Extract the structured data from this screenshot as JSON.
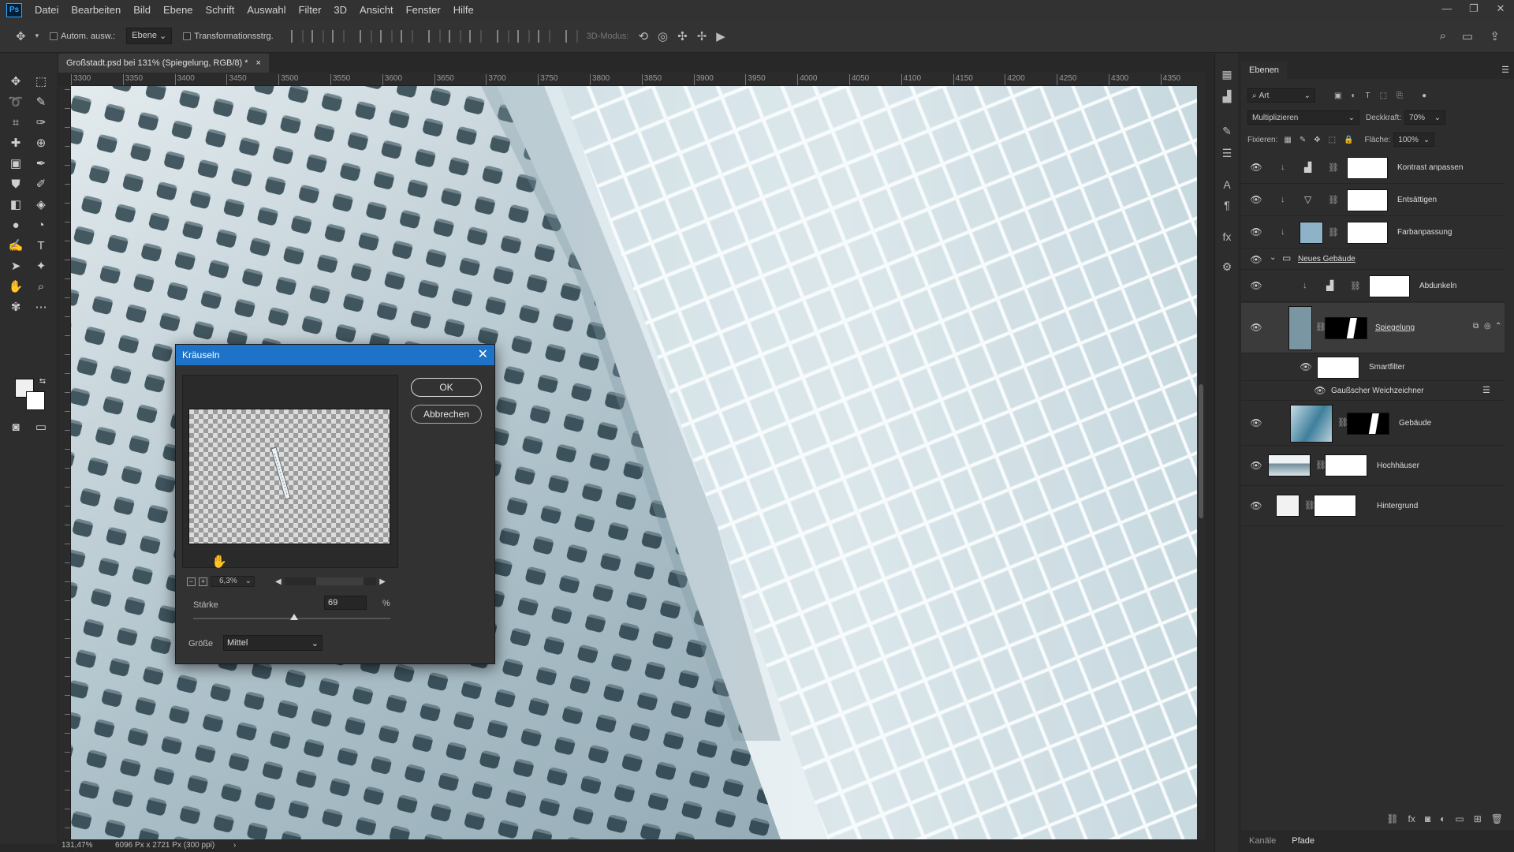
{
  "menu": [
    "Datei",
    "Bearbeiten",
    "Bild",
    "Ebene",
    "Schrift",
    "Auswahl",
    "Filter",
    "3D",
    "Ansicht",
    "Fenster",
    "Hilfe"
  ],
  "app_logo": "Ps",
  "options": {
    "auto_select": "Autom. ausw.:",
    "target": "Ebene",
    "transform": "Transformationsstrg.",
    "mode_3d": "3D-Modus:"
  },
  "document": {
    "tab": "Großstadt.psd bei 131% (Spiegelung, RGB/8) *",
    "tab_close": "×"
  },
  "ruler_ticks": [
    "3300",
    "3350",
    "3400",
    "3450",
    "3500",
    "3550",
    "3600",
    "3650",
    "3700",
    "3750",
    "3800",
    "3850",
    "3900",
    "3950",
    "4000",
    "4050",
    "4100",
    "4150",
    "4200",
    "4250",
    "4300",
    "4350"
  ],
  "status": {
    "zoom": "131,47%",
    "doc_info": "6096 Px x 2721 Px (300 ppi)"
  },
  "dialog": {
    "title": "Kräuseln",
    "ok": "OK",
    "cancel": "Abbrechen",
    "zoom_level": "6,3%",
    "zoom_out": "−",
    "zoom_in": "+",
    "strength_label": "Stärke",
    "strength_value": "69",
    "strength_unit": "%",
    "strength_max": 100,
    "size_label": "Größe",
    "size_value": "Mittel"
  },
  "layers_panel": {
    "tab": "Ebenen",
    "filter_kind": "Art",
    "blend_mode": "Multiplizieren",
    "opacity_label": "Deckkraft:",
    "opacity_value": "70%",
    "lock_label": "Fixieren:",
    "fill_label": "Fläche:",
    "fill_value": "100%",
    "layers": [
      {
        "name": "Kontrast anpassen"
      },
      {
        "name": "Entsättigen"
      },
      {
        "name": "Farbanpassung"
      },
      {
        "name": "Neues Gebäude"
      },
      {
        "name": "Abdunkeln"
      },
      {
        "name": "Spiegelung"
      },
      {
        "name": "Smartfilter"
      },
      {
        "name": "Gaußscher Weichzeichner"
      },
      {
        "name": "Gebäude"
      },
      {
        "name": "Hochhäuser"
      },
      {
        "name": "Hintergrund"
      }
    ]
  },
  "bottom_tabs": [
    "Kanäle",
    "Pfade"
  ],
  "colors": {
    "dialog_title": "#1e73c9",
    "panel": "#2d2d2d",
    "canvas_tint": "#cfdde3"
  }
}
